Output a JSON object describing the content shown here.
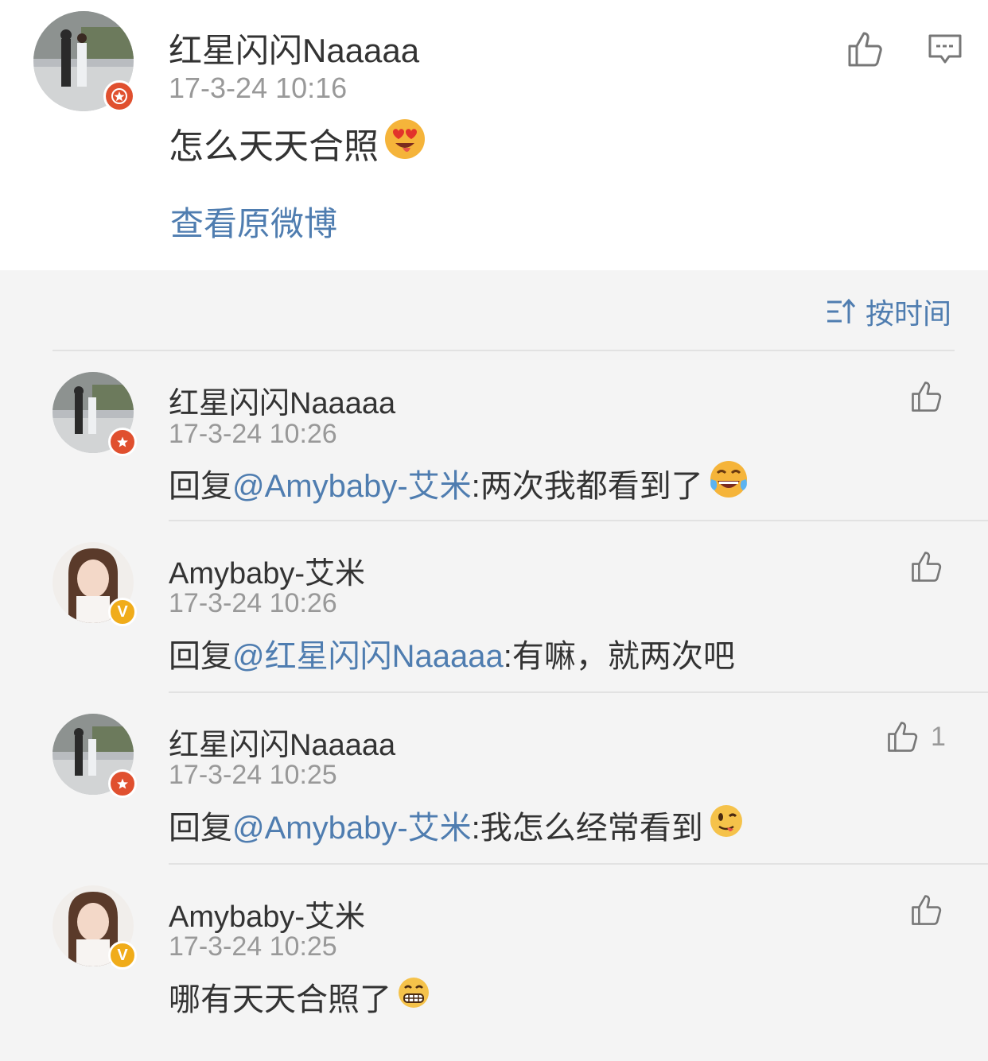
{
  "post": {
    "author": "红星闪闪Naaaaa",
    "time": "17-3-24 10:16",
    "text": "怎么天天合照",
    "emoji": "heart-eyes-tongue-emoji",
    "view_original": "查看原微博",
    "like_icon": "thumbs-up-icon",
    "comment_icon": "comment-icon"
  },
  "sort": {
    "label": "按时间",
    "icon": "sort-icon"
  },
  "comments": [
    {
      "author": "红星闪闪Naaaaa",
      "time": "17-3-24 10:26",
      "prefix": "回复",
      "mention": "@Amybaby-艾米",
      "text": ":两次我都看到了",
      "emoji": "laugh-cry-emoji",
      "badge": "red",
      "likes": ""
    },
    {
      "author": "Amybaby-艾米",
      "time": "17-3-24 10:26",
      "prefix": "回复",
      "mention": "@红星闪闪Naaaaa",
      "text": ":有嘛，就两次吧",
      "emoji": "",
      "badge": "gold",
      "likes": ""
    },
    {
      "author": "红星闪闪Naaaaa",
      "time": "17-3-24 10:25",
      "prefix": "回复",
      "mention": "@Amybaby-艾米",
      "text": ":我怎么经常看到",
      "emoji": "tongue-wink-emoji",
      "badge": "red",
      "likes": "1"
    },
    {
      "author": "Amybaby-艾米",
      "time": "17-3-24 10:25",
      "prefix": "",
      "mention": "",
      "text": "哪有天天合照了",
      "emoji": "grin-emoji",
      "badge": "gold",
      "likes": ""
    }
  ],
  "colors": {
    "link": "#4f7db0",
    "badge_red": "#e0502f",
    "badge_gold": "#f0ac1a",
    "background": "#f4f4f4"
  }
}
